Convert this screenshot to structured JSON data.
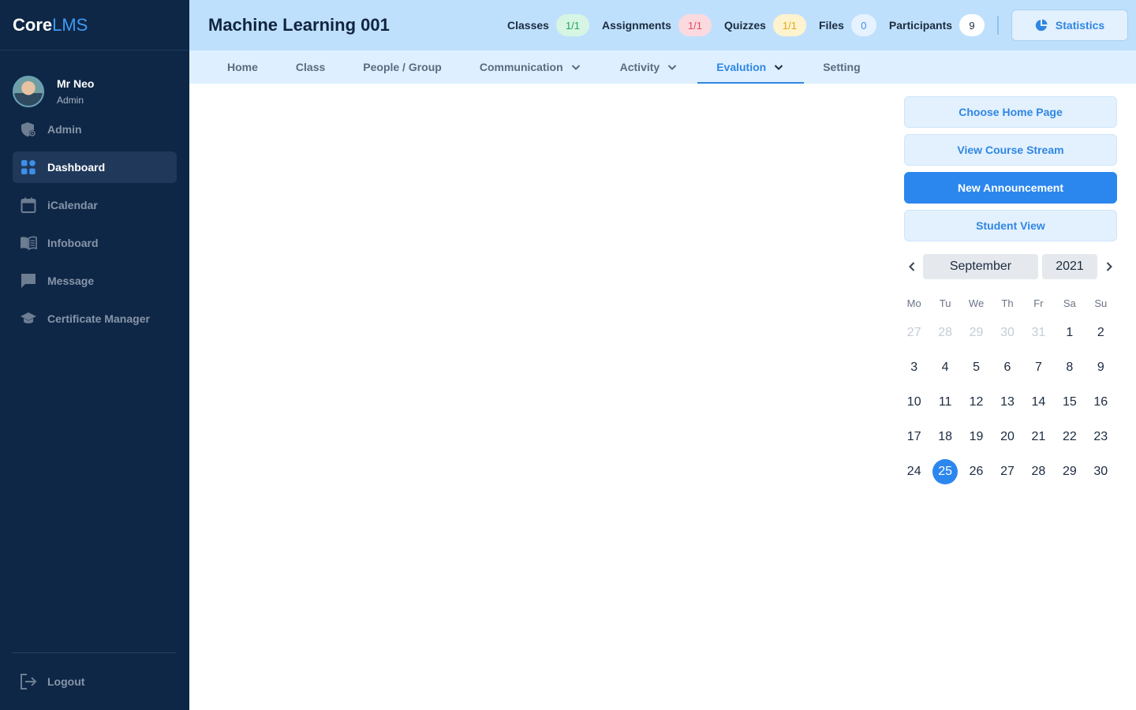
{
  "app": {
    "logo_core": "Core",
    "logo_lms": "LMS"
  },
  "user": {
    "name": "Mr Neo",
    "role": "Admin"
  },
  "sidebar": {
    "items": [
      {
        "label": "Admin",
        "icon": "admin-shield-icon"
      },
      {
        "label": "Dashboard",
        "icon": "dashboard-grid-icon",
        "active": true
      },
      {
        "label": "iCalendar",
        "icon": "calendar-icon"
      },
      {
        "label": "Infoboard",
        "icon": "book-icon"
      },
      {
        "label": "Message",
        "icon": "message-icon"
      },
      {
        "label": "Certificate Manager",
        "icon": "graduation-cap-icon"
      }
    ],
    "logout": "Logout"
  },
  "header": {
    "title": "Machine Learning 001",
    "stats": [
      {
        "label": "Classes",
        "value": "1/1",
        "color": "green"
      },
      {
        "label": "Assignments",
        "value": "1/1",
        "color": "red"
      },
      {
        "label": "Quizzes",
        "value": "1/1",
        "color": "yellow"
      },
      {
        "label": "Files",
        "value": "0",
        "color": "blue"
      },
      {
        "label": "Participants",
        "value": "9",
        "color": "white"
      }
    ],
    "statistics_button": "Statistics"
  },
  "tabs": [
    {
      "label": "Home"
    },
    {
      "label": "Class"
    },
    {
      "label": "People / Group"
    },
    {
      "label": "Communication",
      "dropdown": true
    },
    {
      "label": "Activity",
      "dropdown": true
    },
    {
      "label": "Evalution",
      "dropdown": true,
      "active": true
    },
    {
      "label": "Setting"
    }
  ],
  "actions": {
    "choose_home": "Choose Home Page",
    "view_stream": "View Course Stream",
    "new_announcement": "New Announcement",
    "student_view": "Student View"
  },
  "calendar": {
    "month": "September",
    "year": "2021",
    "weekdays": [
      "Mo",
      "Tu",
      "We",
      "Th",
      "Fr",
      "Sa",
      "Su"
    ],
    "weeks": [
      [
        "27",
        "28",
        "29",
        "30",
        "31",
        "1",
        "2"
      ],
      [
        "3",
        "4",
        "5",
        "6",
        "7",
        "8",
        "9"
      ],
      [
        "10",
        "11",
        "12",
        "13",
        "14",
        "15",
        "16"
      ],
      [
        "17",
        "18",
        "19",
        "20",
        "21",
        "22",
        "23"
      ],
      [
        "24",
        "25",
        "26",
        "27",
        "28",
        "29",
        "30"
      ]
    ],
    "muted_first_row_count": 5,
    "selected": "25"
  },
  "colors": {
    "accent": "#2b87ee",
    "sidebar_bg": "#0f2746",
    "header_bg": "#bfe0fc"
  }
}
